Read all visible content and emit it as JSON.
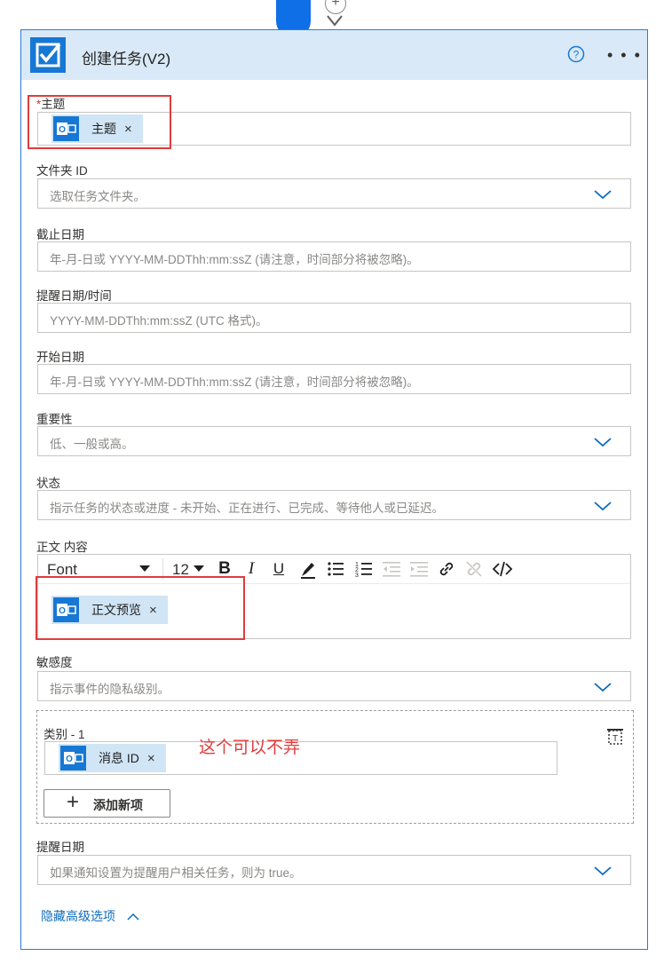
{
  "header": {
    "title": "创建任务(V2)",
    "icon": "task-checkbox-icon"
  },
  "fields": {
    "subject": {
      "required_mark": "*",
      "label": "主题",
      "token": "主题"
    },
    "folder": {
      "label": "文件夹 ID",
      "placeholder": "选取任务文件夹。"
    },
    "due_date": {
      "label": "截止日期",
      "placeholder": "年-月-日或 YYYY-MM-DDThh:mm:ssZ (请注意，时间部分将被忽略)。"
    },
    "reminder_datetime": {
      "label": "提醒日期/时间",
      "placeholder": "YYYY-MM-DDThh:mm:ssZ (UTC 格式)。"
    },
    "start_date": {
      "label": "开始日期",
      "placeholder": "年-月-日或 YYYY-MM-DDThh:mm:ssZ (请注意，时间部分将被忽略)。"
    },
    "importance": {
      "label": "重要性",
      "placeholder": "低、一般或高。"
    },
    "status": {
      "label": "状态",
      "placeholder": "指示任务的状态或进度 - 未开始、正在进行、已完成、等待他人或已延迟。"
    },
    "body": {
      "label": "正文 内容",
      "font": "Font",
      "size": "12",
      "token": "正文预览"
    },
    "sensitivity": {
      "label": "敏感度",
      "placeholder": "指示事件的隐私级别。"
    },
    "categories": {
      "label": "类别 - 1",
      "token": "消息 ID",
      "add_label": "添加新项"
    },
    "reminder": {
      "label": "提醒日期",
      "placeholder": "如果通知设置为提醒用户相关任务，则为 true。"
    }
  },
  "annotation": "这个可以不弄",
  "advanced_label": "隐藏高级选项",
  "colors": {
    "accent": "#1777d4",
    "header_bg": "#d9e9f7",
    "token_bg": "#d0e5f5",
    "annotation": "#e03c3c"
  }
}
